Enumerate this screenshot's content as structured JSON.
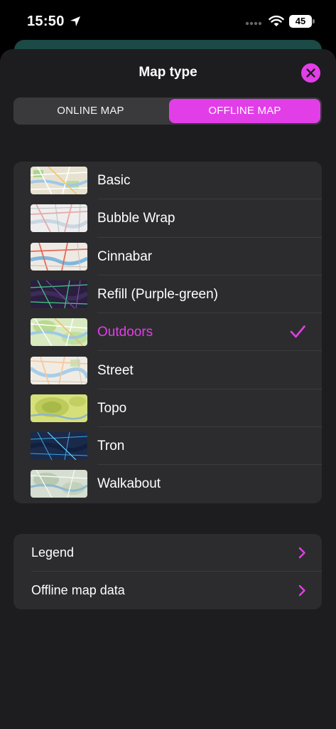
{
  "status_bar": {
    "time": "15:50",
    "battery": "45"
  },
  "sheet": {
    "title": "Map type",
    "tabs": {
      "online": "ONLINE MAP",
      "offline": "OFFLINE MAP",
      "selected": "offline"
    }
  },
  "map_styles": [
    {
      "label": "Basic",
      "selected": false,
      "thumb": "basic"
    },
    {
      "label": "Bubble Wrap",
      "selected": false,
      "thumb": "bubble"
    },
    {
      "label": "Cinnabar",
      "selected": false,
      "thumb": "cinnabar"
    },
    {
      "label": "Refill (Purple-green)",
      "selected": false,
      "thumb": "refill"
    },
    {
      "label": "Outdoors",
      "selected": true,
      "thumb": "outdoors"
    },
    {
      "label": "Street",
      "selected": false,
      "thumb": "street"
    },
    {
      "label": "Topo",
      "selected": false,
      "thumb": "topo"
    },
    {
      "label": "Tron",
      "selected": false,
      "thumb": "tron"
    },
    {
      "label": "Walkabout",
      "selected": false,
      "thumb": "walkabout"
    }
  ],
  "settings": [
    {
      "label": "Legend"
    },
    {
      "label": "Offline map data"
    }
  ],
  "colors": {
    "accent": "#e23ee8",
    "sheet_bg": "#1d1d1f",
    "group_bg": "#2c2c2e"
  }
}
